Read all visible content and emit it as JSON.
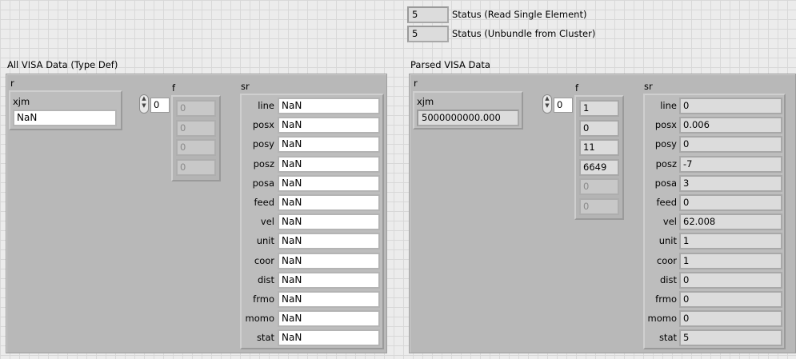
{
  "status": {
    "read_single": {
      "value": "5",
      "label": "Status (Read Single Element)"
    },
    "unbundle": {
      "value": "5",
      "label": "Status (Unbundle from Cluster)"
    }
  },
  "left": {
    "title": "All VISA Data (Type Def)",
    "r_label": "r",
    "xjm_label": "xjm",
    "xjm_value": "NaN",
    "f_label": "f",
    "f_index": "0",
    "f_values": [
      "0",
      "0",
      "0",
      "0"
    ],
    "sr_label": "sr",
    "sr_fields": [
      {
        "name": "line",
        "value": "NaN"
      },
      {
        "name": "posx",
        "value": "NaN"
      },
      {
        "name": "posy",
        "value": "NaN"
      },
      {
        "name": "posz",
        "value": "NaN"
      },
      {
        "name": "posa",
        "value": "NaN"
      },
      {
        "name": "feed",
        "value": "NaN"
      },
      {
        "name": "vel",
        "value": "NaN"
      },
      {
        "name": "unit",
        "value": "NaN"
      },
      {
        "name": "coor",
        "value": "NaN"
      },
      {
        "name": "dist",
        "value": "NaN"
      },
      {
        "name": "frmo",
        "value": "NaN"
      },
      {
        "name": "momo",
        "value": "NaN"
      },
      {
        "name": "stat",
        "value": "NaN"
      }
    ]
  },
  "right": {
    "title": "Parsed VISA Data",
    "r_label": "r",
    "xjm_label": "xjm",
    "xjm_value": "5000000000.000",
    "f_label": "f",
    "f_index": "0",
    "f_values": [
      "1",
      "0",
      "11",
      "6649",
      "0",
      "0"
    ],
    "sr_label": "sr",
    "sr_fields": [
      {
        "name": "line",
        "value": "0"
      },
      {
        "name": "posx",
        "value": "0.006"
      },
      {
        "name": "posy",
        "value": "0"
      },
      {
        "name": "posz",
        "value": "-7"
      },
      {
        "name": "posa",
        "value": "3"
      },
      {
        "name": "feed",
        "value": "0"
      },
      {
        "name": "vel",
        "value": "62.008"
      },
      {
        "name": "unit",
        "value": "1"
      },
      {
        "name": "coor",
        "value": "1"
      },
      {
        "name": "dist",
        "value": "0"
      },
      {
        "name": "frmo",
        "value": "0"
      },
      {
        "name": "momo",
        "value": "0"
      },
      {
        "name": "stat",
        "value": "5"
      }
    ]
  }
}
